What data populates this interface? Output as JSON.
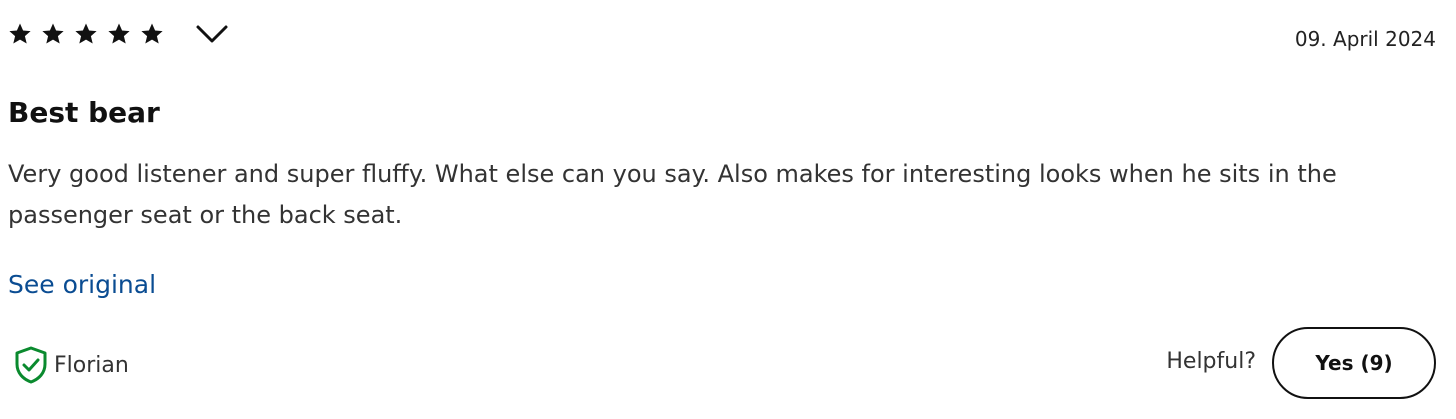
{
  "review": {
    "rating": 5,
    "rating_max": 5,
    "date": "09. April 2024",
    "title": "Best bear",
    "body": "Very good listener and super fluffy. What else can you say. Also makes for interesting looks when he sits in the passenger seat or the back seat.",
    "see_original_label": "See original",
    "author": "Florian",
    "helpful_label": "Helpful?",
    "yes_button_label": "Yes (9)"
  },
  "colors": {
    "star": "#111111",
    "link": "#0a4c92",
    "verified_shield": "#0a8a2e",
    "text": "#333333"
  },
  "icons": {
    "star": "star-icon",
    "expand": "chevron-down-icon",
    "verified": "verified-shield-icon"
  }
}
